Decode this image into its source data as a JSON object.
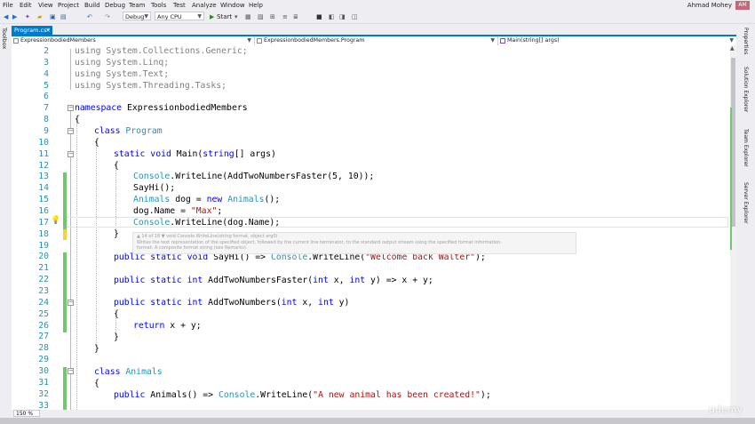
{
  "menu": [
    "File",
    "Edit",
    "View",
    "Project",
    "Build",
    "Debug",
    "Team",
    "Tools",
    "Test",
    "Analyze",
    "Window",
    "Help"
  ],
  "user": {
    "name": "Ahmad Mohey",
    "initials": "AM"
  },
  "toolbar": {
    "config": "Debug",
    "platform": "Any CPU",
    "start_label": "Start"
  },
  "toolbox_label": "Toolbox",
  "tab": {
    "label": "Program.cs*",
    "close": "×"
  },
  "navbar": {
    "project": "ExpressionbodiedMembers",
    "class": "ExpressionbodiedMembers.Program",
    "member": "Main(string[] args)"
  },
  "lines": [
    "2",
    "3",
    "4",
    "5",
    "6",
    "7",
    "8",
    "9",
    "10",
    "11",
    "12",
    "13",
    "14",
    "15",
    "16",
    "17",
    "18",
    "19",
    "20",
    "21",
    "22",
    "23",
    "24",
    "25",
    "26",
    "27",
    "28",
    "29",
    "30",
    "31",
    "32",
    "33"
  ],
  "code": {
    "l2": {
      "kw": "using ",
      "rest": "System.Collections.Generic;"
    },
    "l3": {
      "kw": "using ",
      "rest": "System.Linq;"
    },
    "l4": {
      "kw": "using ",
      "rest": "System.Text;"
    },
    "l5": {
      "kw": "using ",
      "rest": "System.Threading.Tasks;"
    },
    "l7": {
      "kw": "namespace ",
      "rest": "ExpressionbodiedMembers"
    },
    "l8": "{",
    "l9": {
      "kw": "class ",
      "ty": "Program"
    },
    "l10": "{",
    "l11": {
      "kw1": "static ",
      "kw2": "void ",
      "name": "Main(",
      "kw3": "string",
      "rest": "[] args)"
    },
    "l12": "{",
    "l13": {
      "ty": "Console",
      "rest": ".WriteLine(AddTwoNumbersFaster(5, 10));"
    },
    "l14": "SayHi();",
    "l15": {
      "ty": "Animals",
      "mid": " dog = ",
      "kw": "new ",
      "ty2": "Animals",
      "rest": "();"
    },
    "l16": {
      "pre": "dog.Name = ",
      "st": "\"Max\"",
      "rest": ";"
    },
    "l17": {
      "ty": "Console",
      "rest": ".WriteLine(dog.Name);"
    },
    "l18": "}",
    "l20": {
      "kw": "public static void ",
      "name": "SayHi() => ",
      "ty": "Console",
      "mid": ".WriteLine(",
      "st": "\"Welcome back Walter\"",
      "rest": ");"
    },
    "l22": {
      "kw": "public static int ",
      "name": "AddTwoNumbersFaster(",
      "kw2": "int ",
      "a": "x, ",
      "kw3": "int ",
      "rest": "y) => x + y;"
    },
    "l24": {
      "kw": "public static int ",
      "name": "AddTwoNumbers(",
      "kw2": "int ",
      "a": "x, ",
      "kw3": "int ",
      "rest": "y)"
    },
    "l25": "{",
    "l26": {
      "kw": "return ",
      "rest": "x + y;"
    },
    "l27": "}",
    "l28": "}",
    "l30": {
      "kw": "class ",
      "ty": "Animals"
    },
    "l31": "{",
    "l32": {
      "kw": "public ",
      "name": "Animals() => ",
      "ty": "Console",
      "mid": ".WriteLine(",
      "st": "\"A new animal has been created!\"",
      "rest": ");"
    }
  },
  "tooltip": {
    "line1_prefix": "▲ 14 of 18 ▼ void ",
    "line1_sig": "Console.WriteLine(string format, object arg0)",
    "line2": "Writes the text representation of the specified object, followed by the current line terminator, to the standard output stream using the specified format information.",
    "line3": "format: A composite format string (see Remarks)."
  },
  "right_dock": [
    "Properties",
    "Solution Explorer",
    "Team Explorer",
    "Server Explorer"
  ],
  "zoom": "150 %",
  "watermark": "udemy"
}
